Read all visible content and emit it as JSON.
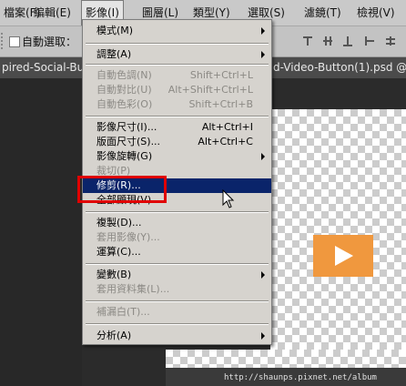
{
  "menubar": {
    "items": [
      {
        "label": "檔案(F)"
      },
      {
        "label": "編輯(E)"
      },
      {
        "label": "影像(I)"
      },
      {
        "label": "圖層(L)"
      },
      {
        "label": "類型(Y)"
      },
      {
        "label": "選取(S)"
      },
      {
        "label": "濾鏡(T)"
      },
      {
        "label": "檢視(V)"
      }
    ]
  },
  "options": {
    "auto_select_label": "自動選取："
  },
  "tabs": [
    {
      "label": "pired-Social-Bu"
    },
    {
      "label": "d-Video-Button(1).psd @"
    }
  ],
  "dropdown": {
    "items": [
      {
        "label": "模式(M)",
        "submenu": true
      },
      {
        "label": "調整(A)",
        "submenu": true
      },
      {
        "label": "自動色調(N)",
        "shortcut": "Shift+Ctrl+L",
        "disabled": true
      },
      {
        "label": "自動對比(U)",
        "shortcut": "Alt+Shift+Ctrl+L",
        "disabled": true
      },
      {
        "label": "自動色彩(O)",
        "shortcut": "Shift+Ctrl+B",
        "disabled": true
      },
      {
        "label": "影像尺寸(I)...",
        "shortcut": "Alt+Ctrl+I"
      },
      {
        "label": "版面尺寸(S)...",
        "shortcut": "Alt+Ctrl+C"
      },
      {
        "label": "影像旋轉(G)",
        "submenu": true
      },
      {
        "label": "裁切(P)",
        "disabled": true
      },
      {
        "label": "修剪(R)...",
        "highlighted": true
      },
      {
        "label": "全部顯現(V)"
      },
      {
        "label": "複製(D)..."
      },
      {
        "label": "套用影像(Y)...",
        "disabled": true
      },
      {
        "label": "運算(C)..."
      },
      {
        "label": "變數(B)",
        "submenu": true
      },
      {
        "label": "套用資料集(L)...",
        "disabled": true
      },
      {
        "label": "補漏白(T)...",
        "disabled": true
      },
      {
        "label": "分析(A)",
        "submenu": true
      }
    ]
  },
  "watermark": "http://shaunps.pixnet.net/album",
  "colors": {
    "highlight": "#0a246a",
    "callout": "#e00000",
    "play_button": "#f0983e"
  }
}
